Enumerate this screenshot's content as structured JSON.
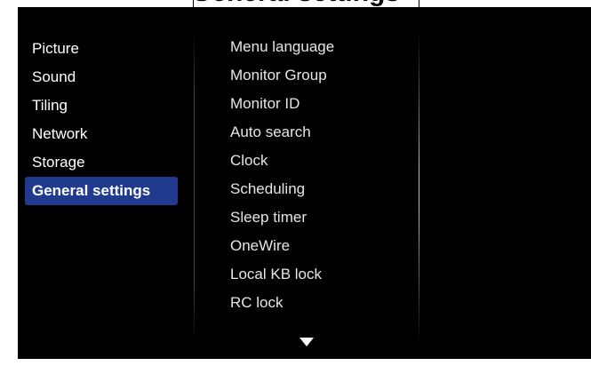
{
  "header": {
    "title": "General settings"
  },
  "main_menu": {
    "items": [
      {
        "label": "Picture"
      },
      {
        "label": "Sound"
      },
      {
        "label": "Tiling"
      },
      {
        "label": "Network"
      },
      {
        "label": "Storage"
      },
      {
        "label": "General settings",
        "selected": true
      }
    ]
  },
  "sub_menu": {
    "items": [
      {
        "label": "Menu language"
      },
      {
        "label": "Monitor Group"
      },
      {
        "label": "Monitor ID"
      },
      {
        "label": "Auto search"
      },
      {
        "label": "Clock"
      },
      {
        "label": "Scheduling"
      },
      {
        "label": "Sleep timer"
      },
      {
        "label": "OneWire"
      },
      {
        "label": "Local KB lock"
      },
      {
        "label": "RC lock"
      }
    ],
    "more_indicator": "triangle-down-icon"
  },
  "colors": {
    "background": "#000000",
    "selected_highlight": "#1f3a8f",
    "text": "#ffffff"
  }
}
